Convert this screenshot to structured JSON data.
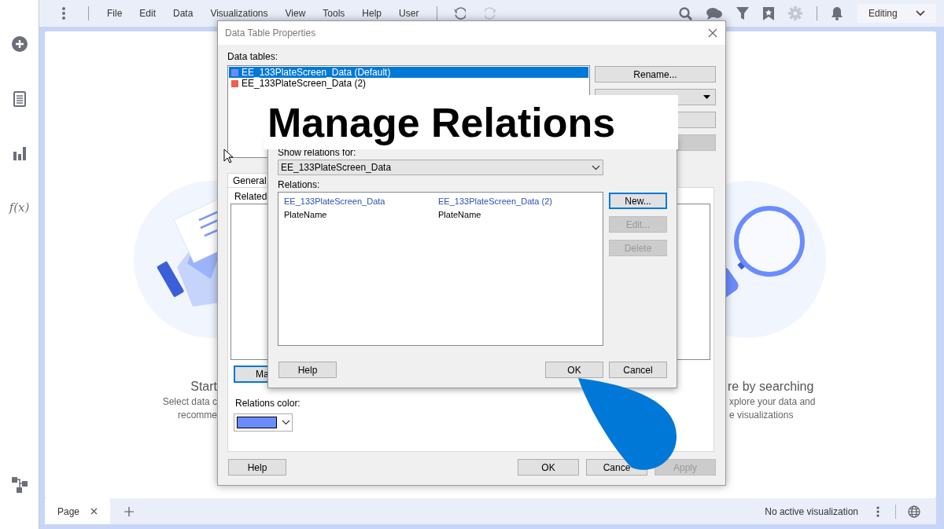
{
  "menu_bar": {
    "items": [
      "File",
      "Edit",
      "Data",
      "Visualizations",
      "View",
      "Tools",
      "Help",
      "User"
    ]
  },
  "history": [
    {
      "kind": "undo",
      "disabled": false
    },
    {
      "kind": "redo",
      "disabled": true
    }
  ],
  "tools": [
    {
      "kind": "search",
      "disabled": false
    },
    {
      "kind": "comments",
      "disabled": false
    },
    {
      "kind": "filter",
      "disabled": false
    },
    {
      "kind": "bookmark",
      "disabled": false
    },
    {
      "kind": "settings",
      "disabled": true
    },
    {
      "kind": "notifications",
      "disabled": false
    }
  ],
  "mode_select": {
    "value": "Editing"
  },
  "side_rail": [
    {
      "kind": "add"
    },
    {
      "kind": "data"
    },
    {
      "kind": "visualizations"
    },
    {
      "kind": "formula",
      "label": "f(x)"
    },
    {
      "kind": "flow"
    }
  ],
  "canvas": {
    "left_heading": "Start",
    "left_lines": [
      "Select data c",
      "recomme"
    ],
    "right_heading": "re by searching",
    "right_lines": [
      "xplore your data and",
      "e visualizations"
    ]
  },
  "page_tabs": [
    {
      "label": "Page",
      "selected": true
    }
  ],
  "status_bar": {
    "text": "No active visualization"
  },
  "data_table_dialog": {
    "title": "Data Table Properties",
    "tables_label": "Data tables:",
    "tables": [
      {
        "label": "EE_133PlateScreen_Data (Default)",
        "color": "#6b8cff",
        "selected": true
      },
      {
        "label": "EE_133PlateScreen_Data (2)",
        "color": "#f0604a",
        "selected": false
      }
    ],
    "side_buttons": [
      {
        "kind": "plain",
        "label": "Rename...",
        "disabled": false
      },
      {
        "kind": "split",
        "disabled": false
      },
      {
        "kind": "blank",
        "disabled": false
      },
      {
        "kind": "blank",
        "disabled": true
      }
    ],
    "tabs": [
      {
        "label": "General",
        "selected": true
      }
    ],
    "related_label": "Related",
    "manage_button": "Ma",
    "color_label": "Relations color:",
    "relations_color": {
      "color": "#6b8cff"
    },
    "buttons": [
      {
        "label": "Help",
        "disabled": false
      },
      {
        "label": "OK",
        "disabled": false
      },
      {
        "label": "Cance",
        "disabled": false
      },
      {
        "label": "Apply",
        "disabled": true
      }
    ]
  },
  "relations_dialog": {
    "show_label": "Show relations for:",
    "table_select": "EE_133PlateScreen_Data",
    "relations_label": "Relations:",
    "relations": [
      {
        "kind": "table",
        "from": "EE_133PlateScreen_Data",
        "to": "EE_133PlateScreen_Data (2)"
      },
      {
        "kind": "column",
        "from": "PlateName",
        "to": "PlateName"
      }
    ],
    "side_buttons": [
      {
        "label": "New...",
        "disabled": false,
        "default": true
      },
      {
        "label": "Edit...",
        "disabled": true,
        "default": false
      },
      {
        "label": "Delete",
        "disabled": true,
        "default": false
      }
    ],
    "buttons": [
      {
        "label": "Help",
        "disabled": false
      },
      {
        "label": "OK",
        "disabled": false
      },
      {
        "label": "Cancel",
        "disabled": false
      }
    ]
  },
  "banner": {
    "title": "Manage Relations"
  }
}
